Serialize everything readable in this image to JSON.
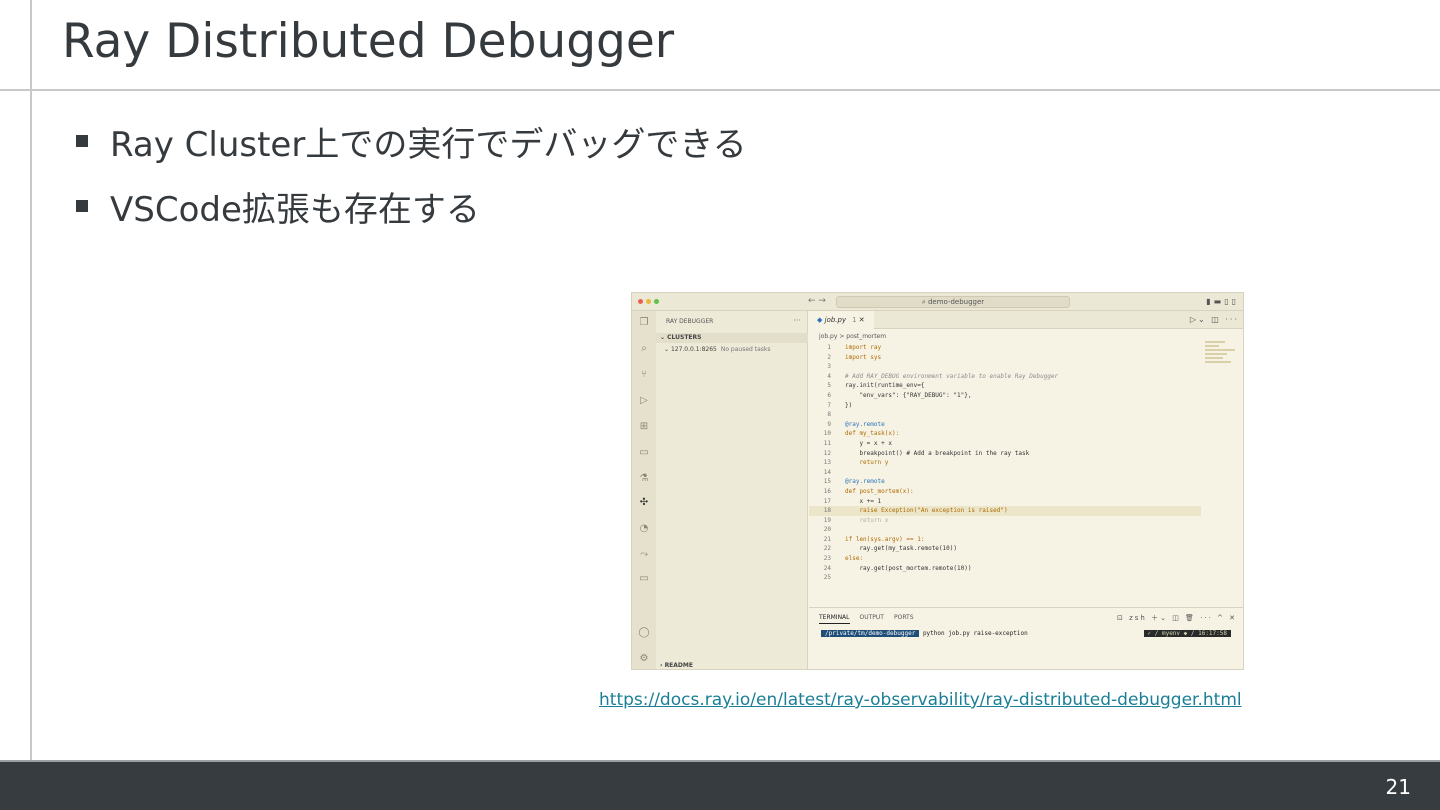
{
  "slide": {
    "title": "Ray Distributed Debugger",
    "bullets": [
      "Ray Cluster上での実行でデバッグできる",
      "VSCode拡張も存在する"
    ],
    "link": "https://docs.ray.io/en/latest/ray-observability/ray-distributed-debugger.html",
    "page_number": "21"
  },
  "screenshot": {
    "search_text": "demo-debugger",
    "sidebar_title": "RAY DEBUGGER",
    "section": "CLUSTERS",
    "cluster_address": "127.0.0.1:8265",
    "cluster_status": "No paused tasks",
    "readme": "README",
    "tab_label": "job.py",
    "tab_badge": "1",
    "breadcrumb": "job.py > post_mortem",
    "terminal_tabs": [
      "TERMINAL",
      "OUTPUT",
      "PORTS"
    ],
    "terminal_shell": "zsh",
    "terminal_path": "/private/tm/demo-debugger",
    "terminal_command": "python job.py raise-exception",
    "terminal_env": "myenv",
    "terminal_time": "16:17:58",
    "code_lines": [
      "import ray",
      "import sys",
      "",
      "# Add RAY_DEBUG environment variable to enable Ray Debugger",
      "ray.init(runtime_env={",
      "    \"env_vars\": {\"RAY_DEBUG\": \"1\"},",
      "})",
      "",
      "@ray.remote",
      "def my_task(x):",
      "    y = x + x",
      "    breakpoint() # Add a breakpoint in the ray task",
      "    return y",
      "",
      "@ray.remote",
      "def post_mortem(x):",
      "    x += 1",
      "    raise Exception(\"An exception is raised\")",
      "    return x",
      "",
      "if len(sys.argv) == 1:",
      "    ray.get(my_task.remote(10))",
      "else:",
      "    ray.get(post_mortem.remote(10))",
      ""
    ]
  },
  "colors": {
    "title_text": "#353a3e",
    "footer_bg": "#373c40",
    "link": "#1a7f96"
  }
}
